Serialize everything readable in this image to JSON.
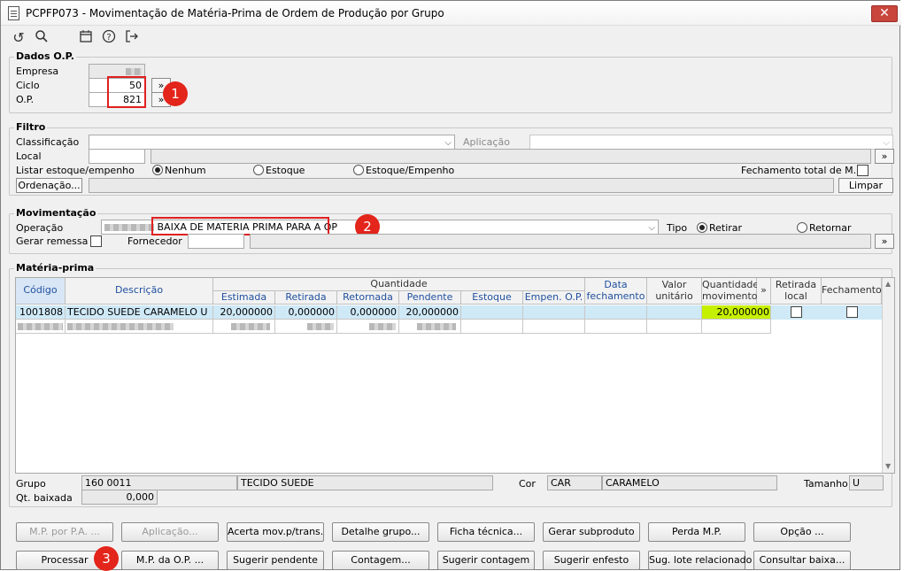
{
  "window": {
    "title": "PCPFP073 - Movimentação de Matéria-Prima de Ordem de Produção por Grupo",
    "close_label": "✕"
  },
  "toolbar": {
    "icons": [
      "undo-icon",
      "search-icon",
      "calendar-icon",
      "help-icon",
      "exit-icon"
    ]
  },
  "dados_op": {
    "title": "Dados O.P.",
    "empresa_label": "Empresa",
    "ciclo_label": "Ciclo",
    "ciclo_value": "50",
    "op_label": "O.P.",
    "op_value": "821",
    "more": "»"
  },
  "filtro": {
    "title": "Filtro",
    "classificacao_label": "Classificação",
    "aplicacao_label": "Aplicação",
    "local_label": "Local",
    "listar_label": "Listar estoque/empenho",
    "radio_nenhum": "Nenhum",
    "radio_estoque": "Estoque",
    "radio_estoque_empenho": "Estoque/Empenho",
    "fechamento_label": "Fechamento total de M.P.",
    "ordenacao_button": "Ordenação...",
    "limpar_button": "Limpar",
    "more": "»"
  },
  "movimentacao": {
    "title": "Movimentação",
    "operacao_label": "Operação",
    "operacao_value": "BAIXA DE MATERIA PRIMA PARA A OP",
    "tipo_label": "Tipo",
    "radio_retirar": "Retirar",
    "radio_retornar": "Retornar",
    "gerar_remessa_label": "Gerar remessa",
    "fornecedor_label": "Fornecedor",
    "more": "»"
  },
  "materia_prima": {
    "title": "Matéria-prima",
    "headers": {
      "codigo": "Código",
      "descricao": "Descrição",
      "quantidade": "Quantidade",
      "estimada": "Estimada",
      "retirada": "Retirada",
      "retornada": "Retornada",
      "pendente": "Pendente",
      "estoque": "Estoque",
      "empen_op": "Empen. O.P.",
      "data_fech_1": "Data",
      "data_fech_2": "fechamento",
      "valor_1": "Valor",
      "valor_2": "unitário",
      "qtd_mov_1": "Quantidade",
      "qtd_mov_2": "movimento",
      "more": "»",
      "retirada_local_1": "Retirada",
      "retirada_local_2": "local",
      "fechamento": "Fechamento"
    },
    "row": {
      "codigo": "1001808",
      "descricao": "TECIDO SUEDE CARAMELO U",
      "estimada": "20,000000",
      "retirada": "0,000000",
      "retornada": "0,000000",
      "pendente": "20,000000",
      "qtd_mov": "20,000000"
    }
  },
  "footer": {
    "grupo_label": "Grupo",
    "grupo_code": "160 0011",
    "grupo_desc": "TECIDO SUEDE",
    "cor_label": "Cor",
    "cor_code": "CAR",
    "cor_desc": "CARAMELO",
    "tamanho_label": "Tamanho",
    "tamanho_value": "U",
    "qt_baixada_label": "Qt. baixada",
    "qt_baixada_value": "0,000"
  },
  "buttons": {
    "mp_por_pa": "M.P. por P.A. ...",
    "aplicacao": "Aplicação...",
    "acerta_mov": "Acerta mov.p/trans.",
    "detalhe_grupo": "Detalhe grupo...",
    "ficha_tecnica": "Ficha técnica...",
    "gerar_subproduto": "Gerar subproduto",
    "perda_mp": "Perda M.P.",
    "opcao": "Opção ...",
    "processar": "Processar",
    "mp_da_op": "M.P. da O.P. ...",
    "sugerir_pendente": "Sugerir pendente",
    "contagem": "Contagem...",
    "sugerir_contagem": "Sugerir contagem",
    "sugerir_enfesto": "Sugerir enfesto",
    "sug_lote": "Sug. lote relacionado",
    "consultar_baixa": "Consultar baixa..."
  },
  "badges": {
    "b1": "1",
    "b2": "2",
    "b3": "3"
  },
  "colors": {
    "accent_red": "#e3251b",
    "header_text": "#1f4f9e",
    "selected_row": "#cfe9f7",
    "highlight": "#c5f000"
  }
}
